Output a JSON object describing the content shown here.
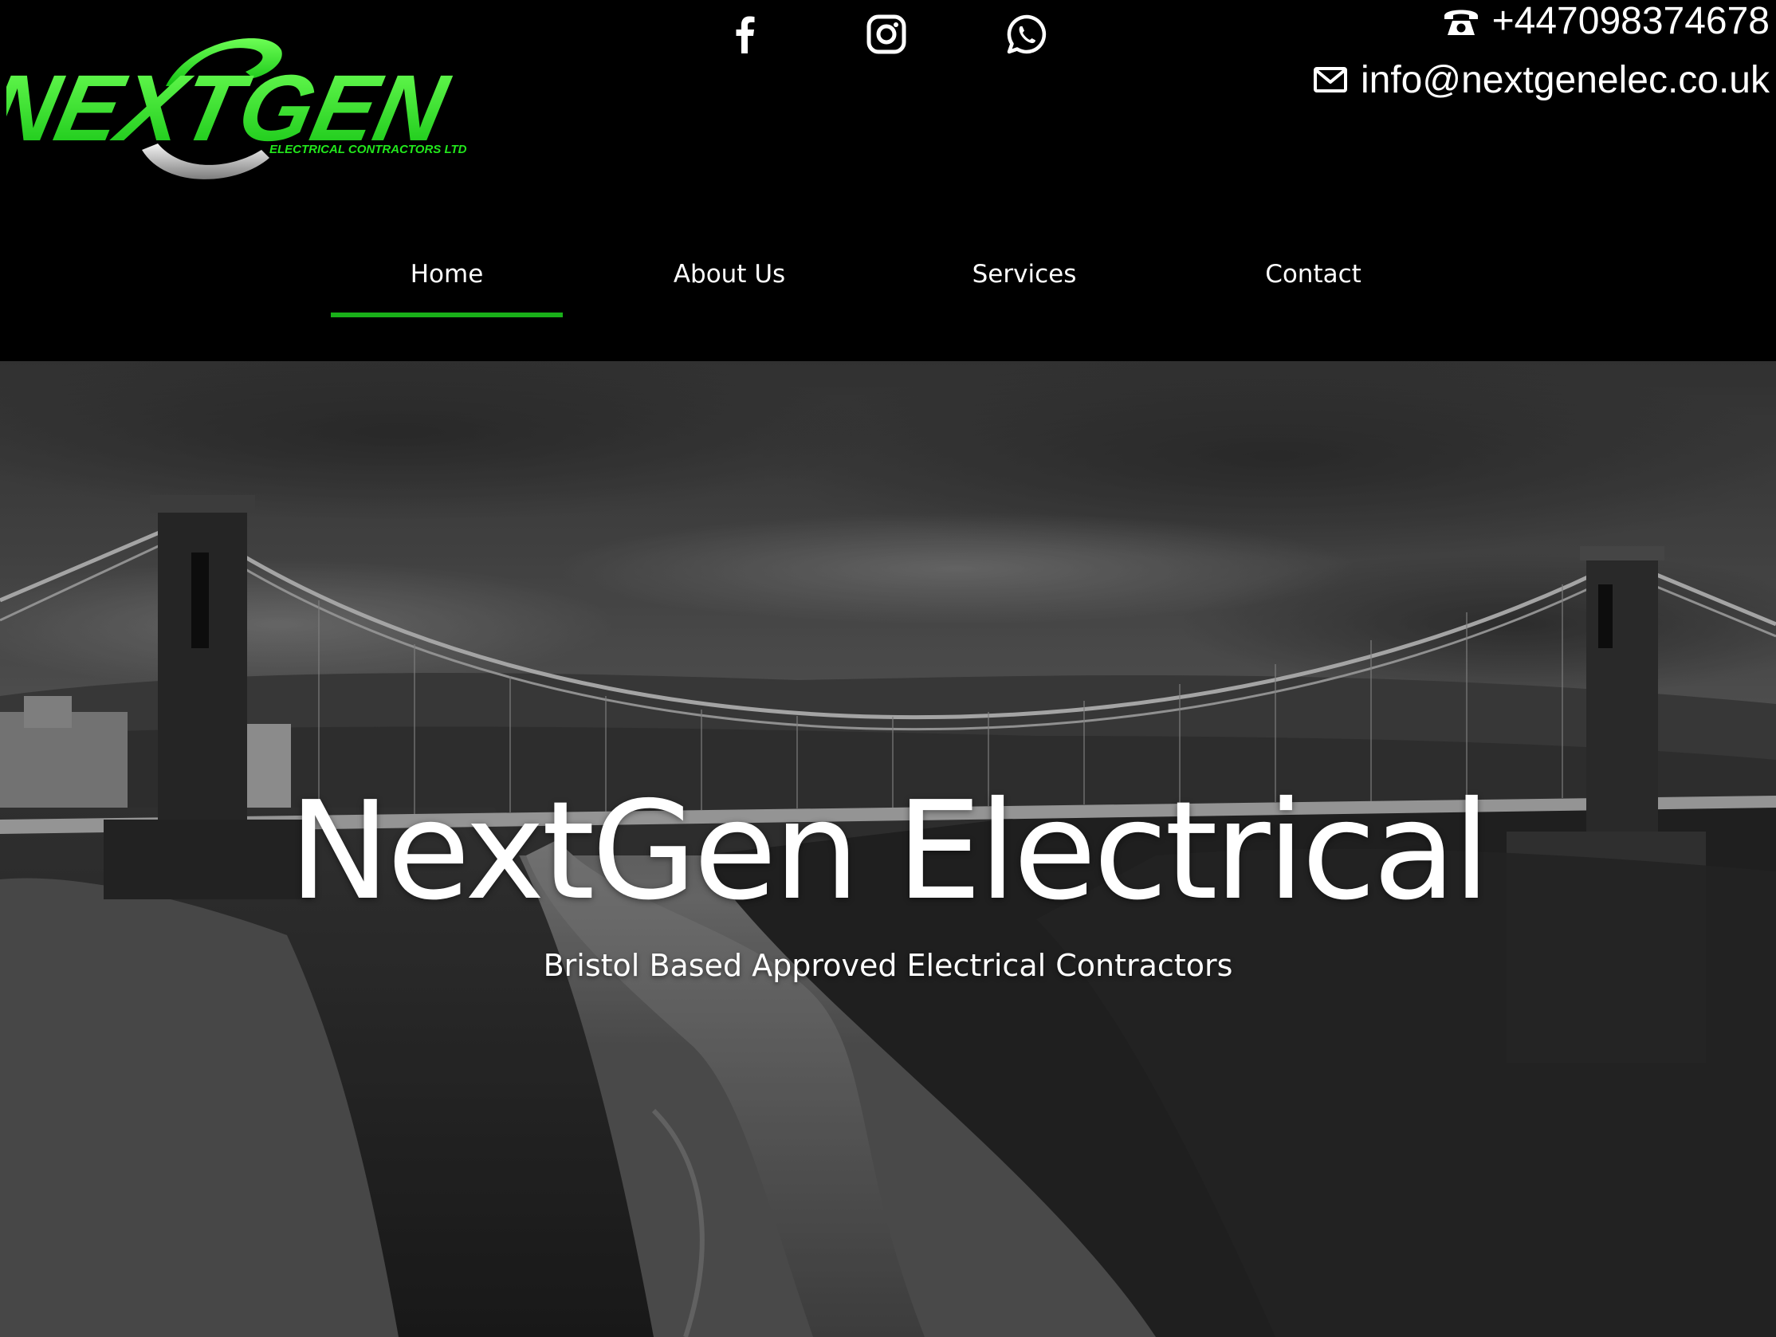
{
  "brand": {
    "logo_wordmark": "NEXTGEN",
    "logo_tagline": "ELECTRICAL CONTRACTORS LTD",
    "accent_color": "#22e81c",
    "nav_underline_color": "#19b019"
  },
  "social": [
    {
      "icon": "facebook-icon"
    },
    {
      "icon": "instagram-icon"
    },
    {
      "icon": "whatsapp-icon"
    }
  ],
  "contact": {
    "phone_icon": "telephone-icon",
    "phone": "+447098374678",
    "email_icon": "envelope-icon",
    "email": "info@nextgenelec.co.uk"
  },
  "nav": {
    "items": [
      {
        "label": "Home",
        "active": true
      },
      {
        "label": "About Us",
        "active": false
      },
      {
        "label": "Services",
        "active": false
      },
      {
        "label": "Contact",
        "active": false
      }
    ]
  },
  "hero": {
    "title": "NextGen Electrical",
    "subtitle": "Bristol Based Approved Electrical Contractors"
  }
}
